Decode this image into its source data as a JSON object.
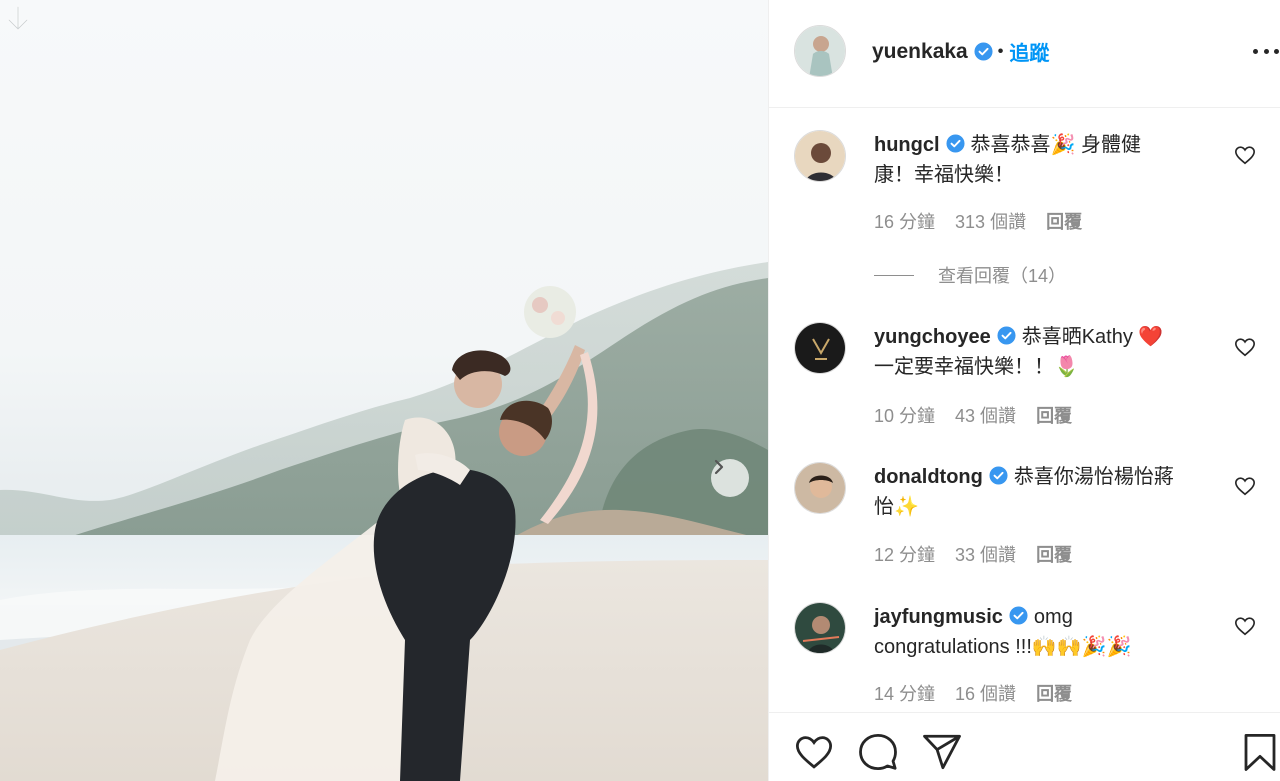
{
  "post": {
    "author": "yuenkaka",
    "follow_label": "追蹤",
    "dot": "•"
  },
  "comments": [
    {
      "user": "hungcl",
      "text_line1": "恭喜恭喜🎉 身體健",
      "text_line2": "康！幸福快樂！",
      "time": "16 分鐘",
      "likes": "313 個讚",
      "reply": "回覆"
    },
    {
      "user": "yungchoyee",
      "text_line1": "恭喜晒Kathy ❤️",
      "text_line2": "一定要幸福快樂！！🌷",
      "time": "10 分鐘",
      "likes": "43 個讚",
      "reply": "回覆"
    },
    {
      "user": "donaldtong",
      "text_line1": "恭喜你湯怡楊怡蔣",
      "text_line2": "怡✨",
      "time": "12 分鐘",
      "likes": "33 個讚",
      "reply": "回覆"
    },
    {
      "user": "jayfungmusic",
      "text_line1": "omg",
      "text_line2": "congratulations !!!🙌🙌🎉🎉",
      "time": "14 分鐘",
      "likes": "16 個讚",
      "reply": "回覆"
    }
  ],
  "view_replies": "查看回覆（14）",
  "icons": {
    "download": "download-arrow-icon",
    "next": "chevron-right-icon",
    "verified": "verified-badge-icon",
    "more": "more-options-icon",
    "like": "heart-icon",
    "comment": "comment-bubble-icon",
    "share": "paper-plane-icon",
    "save": "bookmark-icon"
  },
  "colors": {
    "accent": "#0095f6",
    "text": "#262626",
    "muted": "#8e8e8e",
    "border": "#efefef"
  }
}
